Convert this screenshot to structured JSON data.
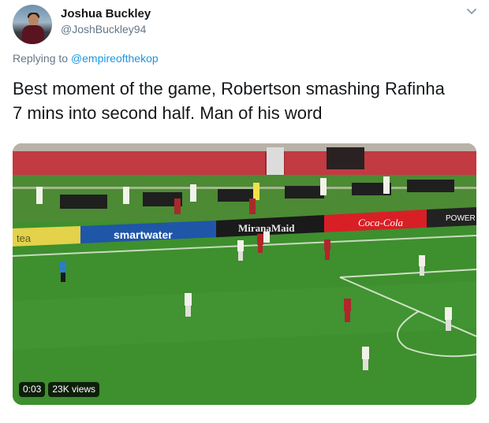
{
  "tweet": {
    "display_name": "Joshua Buckley",
    "handle": "@JoshBuckley94",
    "replying_prefix": "Replying to",
    "replying_to": "@empireofthekop",
    "text": "Best moment of the game, Robertson smashing Rafinha\n7 mins into second half. Man of his word"
  },
  "video": {
    "time": "0:03",
    "views": "23K views",
    "ad_boards": {
      "smartwater": "smartwater",
      "miraemaid": "MiranaMaid",
      "coca_cola": "Coca-Cola",
      "power": "POWER",
      "tea": "tea"
    }
  },
  "icons": {
    "more": "chevron-down-icon"
  },
  "colors": {
    "link": "#1b95e0",
    "secondary_text": "#657786",
    "pitch_green": "#3e8f2e"
  }
}
